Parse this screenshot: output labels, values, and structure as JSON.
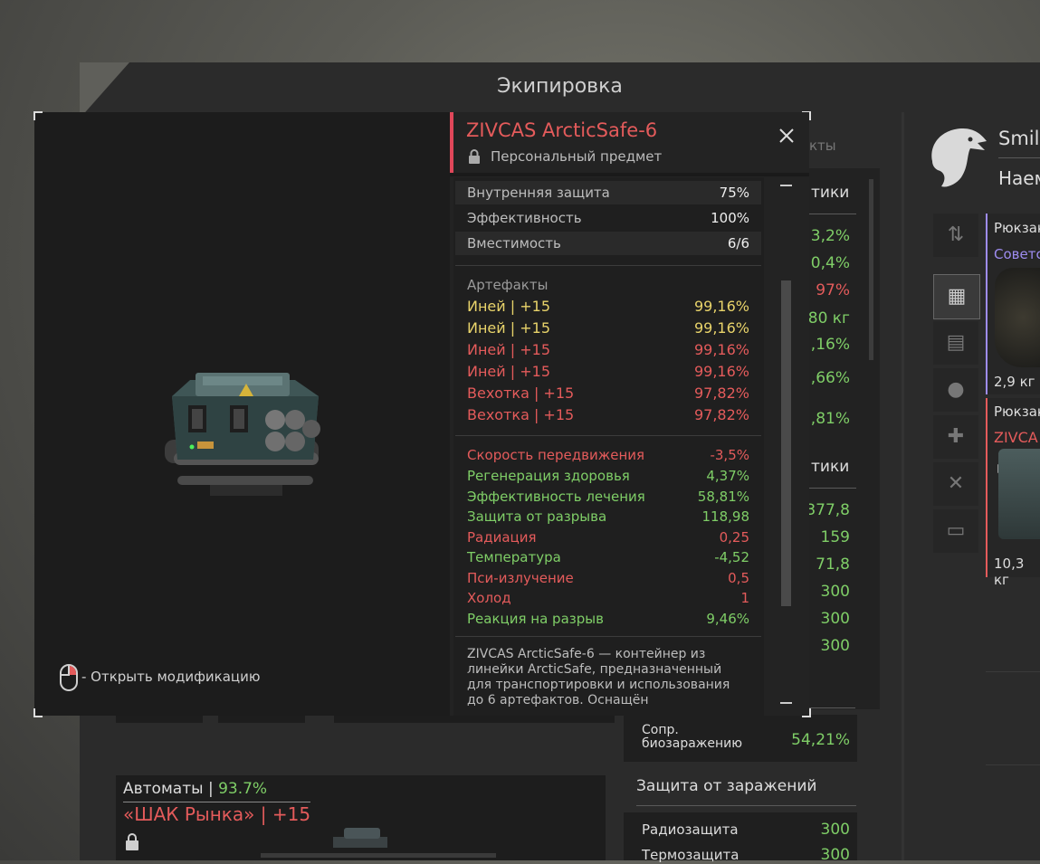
{
  "window": {
    "title": "Экипировка"
  },
  "background_tab_label": "кты",
  "mid_panel": {
    "header1": "тики",
    "values_top": [
      {
        "text": "3,2%",
        "color": "green"
      },
      {
        "text": "0,4%",
        "color": "green"
      },
      {
        "text": "97%",
        "color": "red"
      },
      {
        "text": "80 кг",
        "color": "green"
      },
      {
        "text": ",16%",
        "color": "green"
      },
      {
        "text": ",66%",
        "color": "green"
      },
      {
        "text": ",81%",
        "color": "green"
      }
    ],
    "header2": "тики",
    "values_bottom": [
      "377,8",
      "159",
      "71,8",
      "300",
      "300",
      "300"
    ],
    "bio_label": "Сопр. биозаражению",
    "bio_value": "54,21%",
    "infection_title": "Защита от заражений",
    "radio_label": "Радиозащита",
    "radio_value": "300",
    "thermo_label": "Термозащита",
    "thermo_value": "300"
  },
  "weapon_panel": {
    "category": "Автоматы",
    "separator": "|",
    "percent": "93.7%",
    "name": "«ШАК Рынка»",
    "bonus": "| +15"
  },
  "profile": {
    "name": "Smile",
    "role": "Наем"
  },
  "inventory": [
    {
      "title": "Рюкзак",
      "subtitle": "Советс",
      "weight": "2,9 кг"
    },
    {
      "title": "Рюкзак",
      "subtitle": "ZIVCA",
      "weight": "10,3 кг"
    }
  ],
  "item": {
    "name": "ZIVCAS ArcticSafe-6",
    "personal_label": "Персональный предмет",
    "base_stats": [
      {
        "label": "Внутренняя защита",
        "value": "75%"
      },
      {
        "label": "Эффективность",
        "value": "100%"
      },
      {
        "label": "Вместимость",
        "value": "6/6"
      }
    ],
    "artifacts_title": "Артефакты",
    "artifacts": [
      {
        "name": "Иней | +15",
        "value": "99,16%",
        "color": "yellow"
      },
      {
        "name": "Иней | +15",
        "value": "99,16%",
        "color": "yellow"
      },
      {
        "name": "Иней | +15",
        "value": "99,16%",
        "color": "red"
      },
      {
        "name": "Иней | +15",
        "value": "99,16%",
        "color": "red"
      },
      {
        "name": "Вехотка | +15",
        "value": "97,82%",
        "color": "red"
      },
      {
        "name": "Вехотка | +15",
        "value": "97,82%",
        "color": "red"
      }
    ],
    "effects": [
      {
        "label": "Скорость передвижения",
        "value": "-3,5%",
        "color": "red"
      },
      {
        "label": "Регенерация здоровья",
        "value": "4,37%",
        "color": "green"
      },
      {
        "label": "Эффективность лечения",
        "value": "58,81%",
        "color": "green"
      },
      {
        "label": "Защита от разрыва",
        "value": "118,98",
        "color": "green"
      },
      {
        "label": "Радиация",
        "value": "0,25",
        "color": "red"
      },
      {
        "label": "Температура",
        "value": "-4,52",
        "color": "green"
      },
      {
        "label": "Пси-излучение",
        "value": "0,5",
        "color": "red"
      },
      {
        "label": "Холод",
        "value": "1",
        "color": "red"
      },
      {
        "label": "Реакция на разрыв",
        "value": "9,46%",
        "color": "green"
      }
    ],
    "description": "ZIVCAS ArcticSafe-6 — контейнер из линейки ArcticSafe, предназначенный для транспортировки и использования до 6 артефактов. Оснащён",
    "open_mods_hint": "- Открыть модификацию",
    "close_icon": "close-icon",
    "lock_icon": "lock-icon",
    "mouse_icon": "mouse-icon"
  },
  "colors": {
    "red": "#e45b5b",
    "green": "#7fce67",
    "yellow": "#e8d36a",
    "accent_bar": "#e0475a",
    "artifact_purple": "#9e8cf0"
  }
}
